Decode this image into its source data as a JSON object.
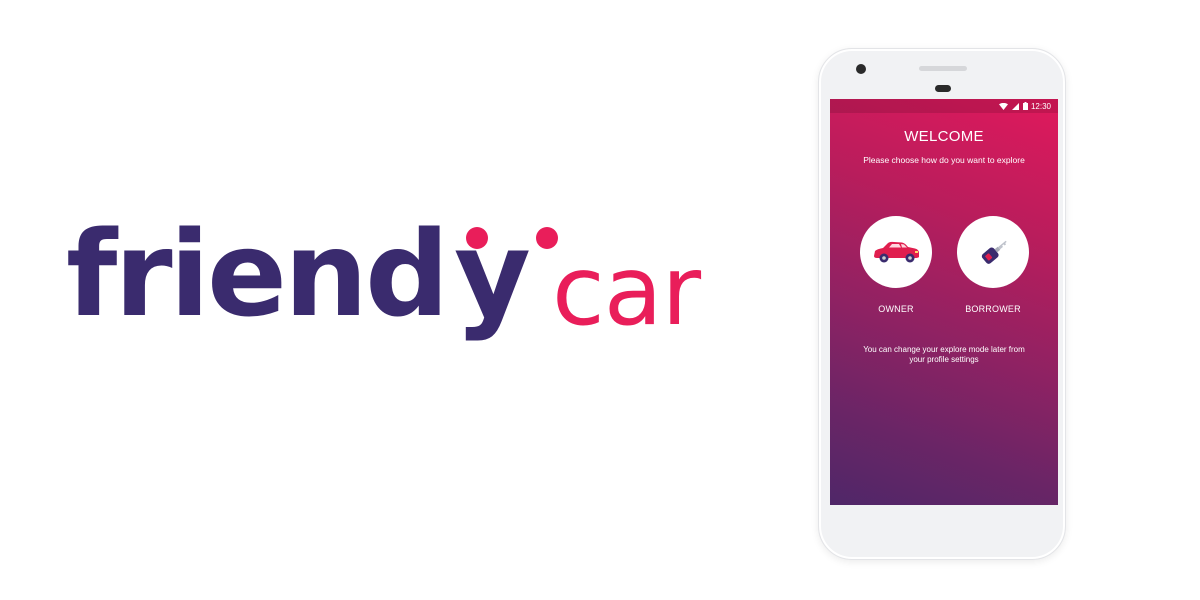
{
  "brand": {
    "part1": "friend",
    "part2": "y",
    "part3": "car",
    "primary_color": "#3a2b6e",
    "accent_color": "#e91e5a"
  },
  "status_bar": {
    "time": "12:30",
    "icons": [
      "wifi-icon",
      "signal-icon",
      "battery-icon"
    ]
  },
  "welcome": {
    "title": "WELCOME",
    "subtitle": "Please choose how do you want to explore"
  },
  "options": [
    {
      "label": "OWNER",
      "icon": "car-icon"
    },
    {
      "label": "BORROWER",
      "icon": "car-key-icon"
    }
  ],
  "note": {
    "line1": "You can change your explore mode later from",
    "line2": "your profile settings"
  }
}
